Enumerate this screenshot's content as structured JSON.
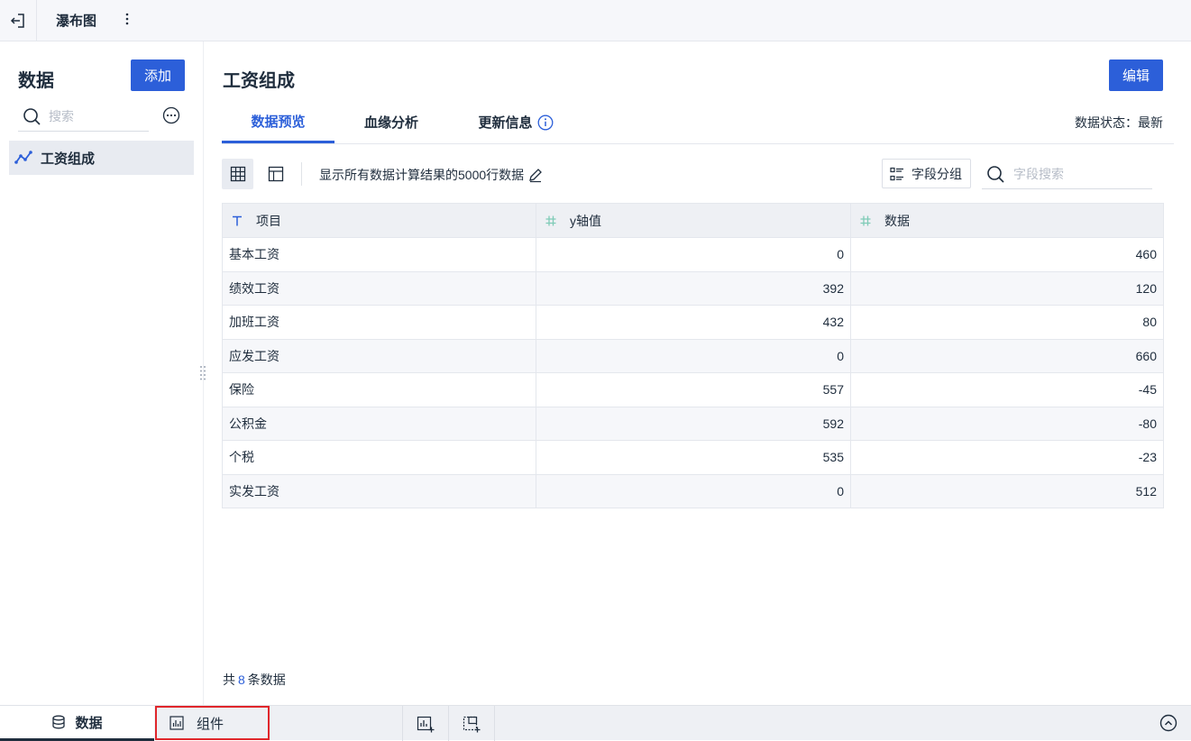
{
  "topbar": {
    "doc_title": "瀑布图"
  },
  "left": {
    "title": "数据",
    "add_label": "添加",
    "search_placeholder": "搜索",
    "dataset_name": "工资组成"
  },
  "main": {
    "title": "工资组成",
    "edit_label": "编辑",
    "tabs": [
      {
        "label": "数据预览",
        "active": true
      },
      {
        "label": "血缘分析",
        "active": false
      },
      {
        "label": "更新信息",
        "active": false
      }
    ],
    "status_text": "数据状态：最新",
    "description": "显示所有数据计算结果的5000行数据",
    "group_label": "字段分组",
    "field_search_placeholder": "字段搜索"
  },
  "table": {
    "columns": [
      {
        "name": "项目",
        "type": "text"
      },
      {
        "name": "y轴值",
        "type": "number"
      },
      {
        "name": "数据",
        "type": "number"
      }
    ],
    "rows": [
      [
        "基本工资",
        "0",
        "460"
      ],
      [
        "绩效工资",
        "392",
        "120"
      ],
      [
        "加班工资",
        "432",
        "80"
      ],
      [
        "应发工资",
        "0",
        "660"
      ],
      [
        "保险",
        "557",
        "-45"
      ],
      [
        "公积金",
        "592",
        "-80"
      ],
      [
        "个税",
        "535",
        "-23"
      ],
      [
        "实发工资",
        "0",
        "512"
      ]
    ],
    "footer_prefix": "共",
    "footer_count": "8",
    "footer_suffix": "条数据"
  },
  "bottombar": {
    "data_label": "数据",
    "component_label": "组件"
  },
  "colors": {
    "accent": "#2c5fd9",
    "highlight": "#e0262b"
  }
}
